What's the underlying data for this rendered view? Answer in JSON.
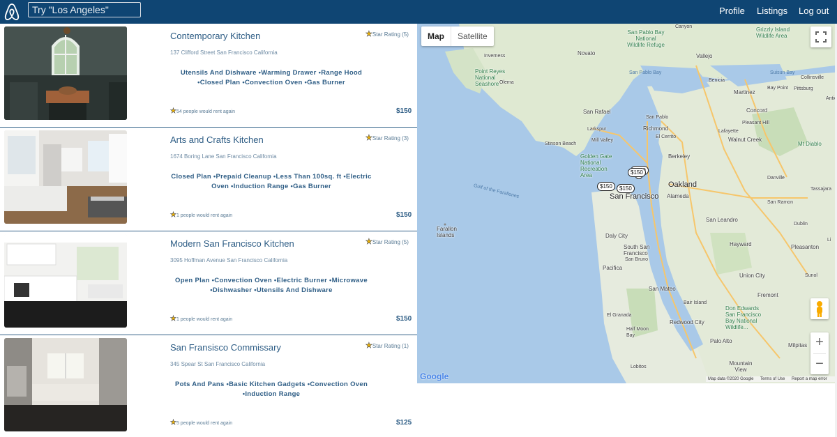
{
  "nav": {
    "search_placeholder": "Try \"Los Angeles\"",
    "links": [
      "Profile",
      "Listings",
      "Log out"
    ]
  },
  "listings": [
    {
      "title": "Contemporary Kitchen",
      "rating_text": "Star Rating (5)",
      "address": "137 Clifford Street San Francisco California",
      "amenities": "Utensils And Dishware •Warming Drawer •Range Hood •Closed Plan •Convection Oven •Gas Burner",
      "rent_again": "54 people would rent again",
      "price": "$150"
    },
    {
      "title": "Arts and Crafts Kitchen",
      "rating_text": "Star Rating (3)",
      "address": "1674 Boring Lane San Francisco California",
      "amenities": "Closed Plan •Prepaid Cleanup •Less Than 100sq. ft •Electric Oven •Induction Range •Gas Burner",
      "rent_again": "1 people would rent again",
      "price": "$150"
    },
    {
      "title": "Modern San Francisco Kitchen",
      "rating_text": "Star Rating (5)",
      "address": "3095 Hoffman Avenue San Francisco California",
      "amenities": "Open Plan •Convection Oven •Electric Burner •Microwave •Dishwasher •Utensils And Dishware",
      "rent_again": "1 people would rent again",
      "price": "$150"
    },
    {
      "title": "San Fransisco Commissary",
      "rating_text": "Star Rating (1)",
      "address": "345 Spear St San Francisco California",
      "amenities": "Pots And Pans •Basic Kitchen Gadgets •Convection Oven •Induction Range",
      "rent_again": "5 people would rent again",
      "price": "$125"
    }
  ],
  "map": {
    "type_buttons": [
      "Map",
      "Satellite"
    ],
    "google_label": "Google",
    "attribution": [
      "Map data ©2020 Google",
      "Terms of Use",
      "Report a map error"
    ],
    "price_pins": [
      "$150",
      "$150",
      "$150",
      "$150",
      "5"
    ],
    "place_labels": {
      "san_francisco": "San Francisco",
      "oakland": "Oakland",
      "berkeley": "Berkeley",
      "san_rafael": "San Rafael",
      "richmond": "Richmond",
      "daly_city": "Daly City",
      "san_mateo": "San Mateo",
      "hayward": "Hayward",
      "fremont": "Fremont",
      "concord": "Concord",
      "walnut_creek": "Walnut Creek",
      "san_leandro": "San Leandro",
      "pleasanton": "Pleasanton",
      "union_city": "Union City",
      "palo_alto": "Palo Alto",
      "redwood_city": "Redwood City",
      "vallejo": "Vallejo",
      "novato": "Novato",
      "martinez": "Martinez",
      "alameda": "Alameda",
      "pacifica": "Pacifica",
      "south_san_francisco": "South San Francisco",
      "san_bruno": "San Bruno",
      "mill_valley": "Mill Valley",
      "larkspur": "Larkspur",
      "el_cerrito": "El Cerrito",
      "lafayette": "Lafayette",
      "danville": "Danville",
      "san_ramon": "San Ramon",
      "dublin": "Dublin",
      "tassajara": "Tassajara",
      "milpitas": "Milpitas",
      "mountain_view": "Mountain View",
      "el_granada": "El Granada",
      "half_moon_bay": "Half Moon Bay",
      "lobitos": "Lobitos",
      "inverness": "Inverness",
      "point_reyes": "Point Reyes National Seashore",
      "olema": "Olema",
      "stinson_beach": "Stinson Beach",
      "golden_gate": "Golden Gate National Recreation Area",
      "farallon": "Farallon Islands",
      "gulf": "Gulf of the Farallones",
      "san_pablo_bay": "San Pablo Bay",
      "san_pablo_refuge": "San Pablo Bay National Wildlife Refuge",
      "canyon": "Canyon",
      "grizzly": "Grizzly Island Wildlife Area",
      "suisun_bay": "Suisun Bay",
      "collinsville": "Collinsville",
      "bay_point": "Bay Point",
      "pittsburg": "Pittsburg",
      "antioch": "Antio",
      "benicia": "Benicia",
      "pleasant_hill": "Pleasant Hill",
      "mt_diablo": "Mt Diablo",
      "san_pablo": "San Pablo",
      "sunol": "Sunol",
      "bair_island": "Bair Island",
      "don_edwards": "Don Edwards San Francisco Bay National Wildlife...",
      "li": "Li"
    }
  }
}
